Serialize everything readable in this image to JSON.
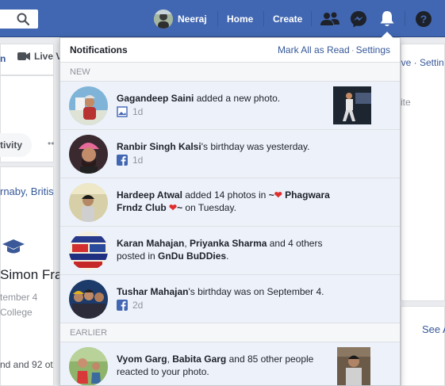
{
  "topbar": {
    "user_name": "Neeraj",
    "home": "Home",
    "create": "Create"
  },
  "background": {
    "left_partial_1": "n",
    "live_label": "Live V",
    "activity": "tivity",
    "dots": "••",
    "burnaby": "rnaby, Britis",
    "simon": "Simon Fra",
    "sept": "tember 4",
    "college": "College",
    "others": "nd and 92 ot",
    "right_live": "ive · Settin",
    "right_ite": "ite",
    "see_all": "See A"
  },
  "panel": {
    "title": "Notifications",
    "mark_all": "Mark All as Read",
    "settings": "Settings",
    "section_new": "NEW",
    "section_earlier": "EARLIER"
  },
  "notifications": [
    {
      "actor": "Gagandeep Saini",
      "text": " added a new photo.",
      "time": "1d",
      "icon": "photo-icon"
    },
    {
      "actor": "Ranbir Singh Kalsi",
      "text": "'s birthday was yesterday.",
      "time": "1d",
      "icon": "facebook-icon"
    },
    {
      "actor": "Hardeep Atwal",
      "text_a": " added 14 photos in ",
      "group_pre": "~",
      "heart": "❤",
      "group_name": " Phagwara Frndz Club ",
      "group_post": "~",
      "text_b": " on Tuesday."
    },
    {
      "actor_a": "Karan Mahajan",
      "comma": ", ",
      "actor_b": "Priyanka Sharma",
      "text": " and 4 others posted in ",
      "group": "GnDu BuDDies",
      "end": "."
    },
    {
      "actor": "Tushar Mahajan",
      "text": "'s birthday was on September 4.",
      "time": "2d",
      "icon": "facebook-icon"
    },
    {
      "actor_a": "Vyom Garg",
      "comma": ", ",
      "actor_b": "Babita Garg",
      "text": " and 85 other people reacted to your photo."
    }
  ],
  "colors": {
    "brand": "#4267b2",
    "link": "#365899",
    "unread_bg": "#edf2fa",
    "heart": "#e02e2e"
  }
}
